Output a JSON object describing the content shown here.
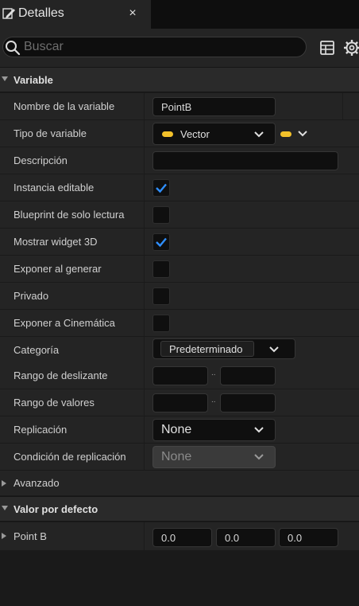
{
  "tab": {
    "title": "Detalles",
    "close_glyph": "×"
  },
  "search": {
    "placeholder": "Buscar",
    "value": ""
  },
  "sections": {
    "variable": "Variable",
    "advanced": "Avanzado",
    "default_value": "Valor por defecto"
  },
  "fields": {
    "variable_name": {
      "label": "Nombre de la variable",
      "value": "PointB"
    },
    "variable_type": {
      "label": "Tipo de variable",
      "value": "Vector",
      "pin_color": "#f3c12a"
    },
    "description": {
      "label": "Descripción",
      "value": ""
    },
    "instance_editable": {
      "label": "Instancia editable",
      "checked": true
    },
    "blueprint_read_only": {
      "label": "Blueprint de solo lectura",
      "checked": false
    },
    "show_3d_widget": {
      "label": "Mostrar widget 3D",
      "checked": true
    },
    "expose_on_spawn": {
      "label": "Exponer al generar",
      "checked": false
    },
    "private": {
      "label": "Privado",
      "checked": false
    },
    "expose_to_cinematics": {
      "label": "Exponer a Cinemática",
      "checked": false
    },
    "category": {
      "label": "Categoría",
      "value": "Predeterminado"
    },
    "slider_range": {
      "label": "Rango de deslizante",
      "separator": "..",
      "min": "",
      "max": ""
    },
    "value_range": {
      "label": "Rango de valores",
      "separator": "..",
      "min": "",
      "max": ""
    },
    "replication": {
      "label": "Replicación",
      "value": "None"
    },
    "replication_condition": {
      "label": "Condición de replicación",
      "value": "None"
    },
    "point_b": {
      "label": "Point B",
      "x": "0.0",
      "y": "0.0",
      "z": "0.0"
    }
  },
  "colors": {
    "accent_check": "#2f8fff",
    "type_pill": "#f3c12a"
  },
  "icons": [
    "pencil-icon",
    "close-icon",
    "search-icon",
    "table-icon",
    "gear-icon",
    "chevron-down-icon",
    "checkmark-icon"
  ]
}
